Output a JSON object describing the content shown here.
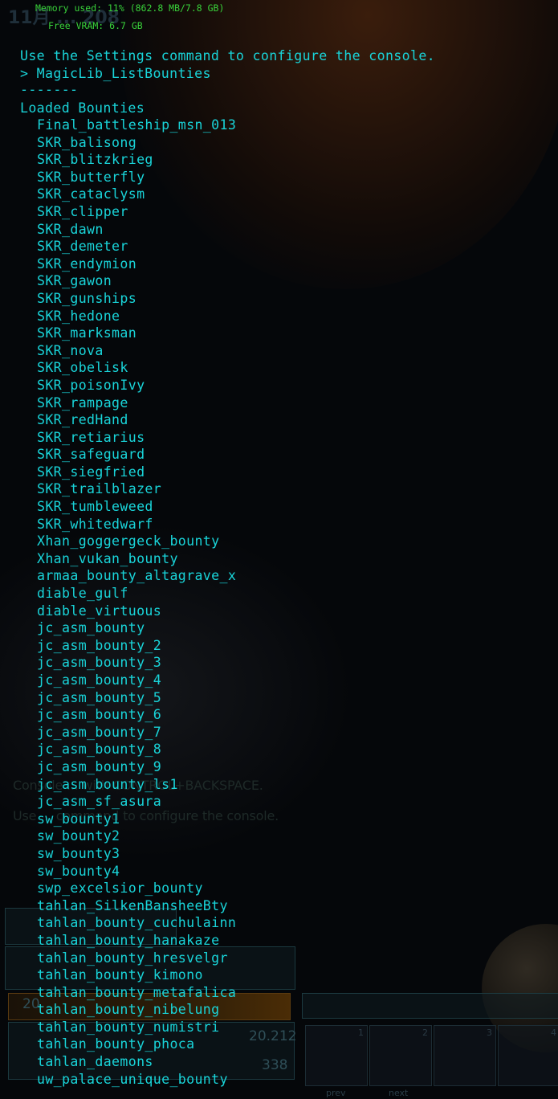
{
  "background": {
    "date_label": "11月 ... 208",
    "ghost_console_lines": [
      "Console ... with CONTROL+BACKSPACE.",
      "Use ... command to configure the console."
    ],
    "hud": {
      "value_a": "20.212",
      "value_b": "338",
      "value_c": "20",
      "prev_label": "prev",
      "next_label": "next",
      "slot_numbers": [
        "1",
        "2",
        "3",
        "4"
      ]
    }
  },
  "console": {
    "memory_used": "Memory used: 11% (862.8 MB/7.8 GB)",
    "free_vram": "Free VRAM: 6.7 GB",
    "settings_hint": "Use the Settings command to configure the console.",
    "command": "> MagicLib_ListBounties",
    "separator": "-------",
    "section_header": "Loaded Bounties",
    "bounties": [
      "Final_battleship_msn_013",
      "SKR_balisong",
      "SKR_blitzkrieg",
      "SKR_butterfly",
      "SKR_cataclysm",
      "SKR_clipper",
      "SKR_dawn",
      "SKR_demeter",
      "SKR_endymion",
      "SKR_gawon",
      "SKR_gunships",
      "SKR_hedone",
      "SKR_marksman",
      "SKR_nova",
      "SKR_obelisk",
      "SKR_poisonIvy",
      "SKR_rampage",
      "SKR_redHand",
      "SKR_retiarius",
      "SKR_safeguard",
      "SKR_siegfried",
      "SKR_trailblazer",
      "SKR_tumbleweed",
      "SKR_whitedwarf",
      "Xhan_goggergeck_bounty",
      "Xhan_vukan_bounty",
      "armaa_bounty_altagrave_x",
      "diable_gulf",
      "diable_virtuous",
      "jc_asm_bounty",
      "jc_asm_bounty_2",
      "jc_asm_bounty_3",
      "jc_asm_bounty_4",
      "jc_asm_bounty_5",
      "jc_asm_bounty_6",
      "jc_asm_bounty_7",
      "jc_asm_bounty_8",
      "jc_asm_bounty_9",
      "jc_asm_bounty_ls1",
      "jc_asm_sf_asura",
      "sw_bounty1",
      "sw_bounty2",
      "sw_bounty3",
      "sw_bounty4",
      "swp_excelsior_bounty",
      "tahlan_SilkenBansheeBty",
      "tahlan_bounty_cuchulainn",
      "tahlan_bounty_hanakaze",
      "tahlan_bounty_hresvelgr",
      "tahlan_bounty_kimono",
      "tahlan_bounty_metafalica",
      "tahlan_bounty_nibelung",
      "tahlan_bounty_numistri",
      "tahlan_bounty_phoca",
      "tahlan_daemons",
      "uw_palace_unique_bounty"
    ]
  },
  "colors": {
    "console_text": "#19d4d9",
    "memory_text": "#39d23a",
    "background": "#05070a"
  }
}
